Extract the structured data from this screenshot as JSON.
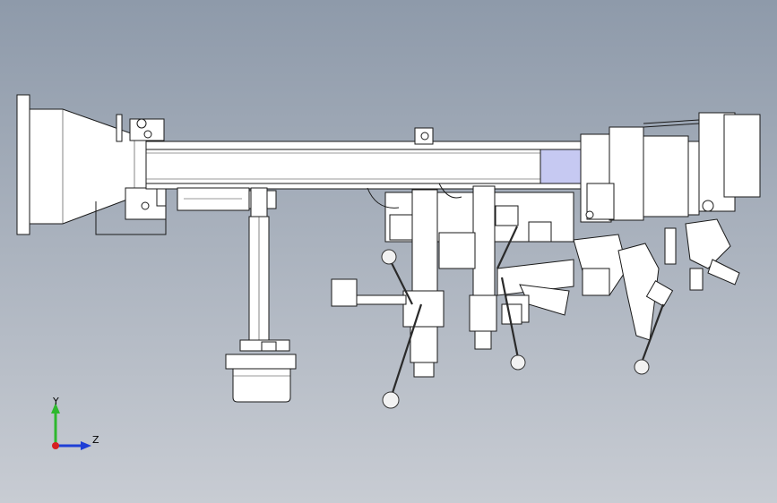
{
  "view": {
    "background_top": "#8e9aaa",
    "background_bottom": "#c8ccd3",
    "highlight_color": "#c6c9f2"
  },
  "triad": {
    "y_label": "Y",
    "z_label": "Z",
    "y_color": "#2eb82e",
    "z_color": "#1f3fd6",
    "x_color": "#d62020"
  }
}
